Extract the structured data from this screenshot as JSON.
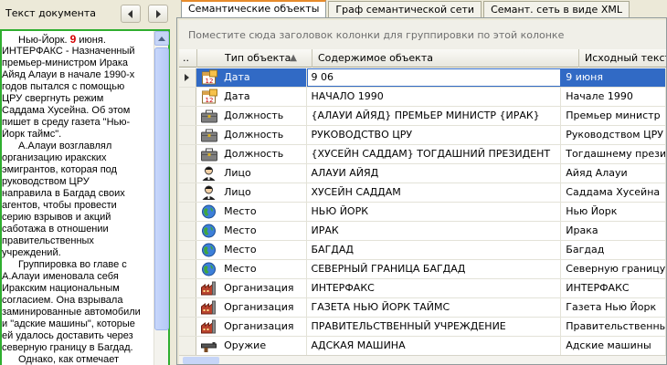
{
  "left_panel": {
    "title": "Текст документа",
    "document_lines": [
      {
        "parts": [
          {
            "t": "Нью-Йорк. "
          },
          {
            "t": "9",
            "hl": true
          },
          {
            "t": " июня."
          }
        ],
        "indent": true
      },
      {
        "parts": [
          {
            "t": "ИНТЕРФАКС - Назначенный"
          }
        ]
      },
      {
        "parts": [
          {
            "t": "премьер-министром Ирака"
          }
        ]
      },
      {
        "parts": [
          {
            "t": "Айяд  Алауи  в начале 1990-х"
          }
        ]
      },
      {
        "parts": [
          {
            "t": "годов пытался  с  помощью"
          }
        ]
      },
      {
        "parts": [
          {
            "t": "ЦРУ свергнуть  режим"
          }
        ]
      },
      {
        "parts": [
          {
            "t": "Саддама Хусейна.  Об этом"
          }
        ]
      },
      {
        "parts": [
          {
            "t": "пишет  в  среду газета \"Нью-"
          }
        ]
      },
      {
        "parts": [
          {
            "t": "Йорк таймс\"."
          }
        ]
      },
      {
        "parts": [
          {
            "t": "А.Алауи возглавлял"
          }
        ],
        "indent": true
      },
      {
        "parts": [
          {
            "t": "организацию иракских"
          }
        ]
      },
      {
        "parts": [
          {
            "t": "эмигрантов, которая под"
          }
        ]
      },
      {
        "parts": [
          {
            "t": "руководством   ЦРУ"
          }
        ]
      },
      {
        "parts": [
          {
            "t": "направила в Багдад своих"
          }
        ]
      },
      {
        "parts": [
          {
            "t": "агентов,  чтобы провести"
          }
        ]
      },
      {
        "parts": [
          {
            "t": "серию  взрывов  и  акций"
          }
        ]
      },
      {
        "parts": [
          {
            "t": "саботажа  в  отношении"
          }
        ]
      },
      {
        "parts": [
          {
            "t": "правительственных"
          }
        ]
      },
      {
        "parts": [
          {
            "t": "учреждений."
          }
        ]
      },
      {
        "parts": [
          {
            "t": "Группировка  во главе с"
          }
        ],
        "indent": true
      },
      {
        "parts": [
          {
            "t": "А.Алауи именовала  себя"
          }
        ]
      },
      {
        "parts": [
          {
            "t": "Иракским национальным"
          }
        ]
      },
      {
        "parts": [
          {
            "t": "согласием.  Она взрывала"
          }
        ]
      },
      {
        "parts": [
          {
            "t": "заминированные  автомобили"
          }
        ]
      },
      {
        "parts": [
          {
            "t": "и \"адские машины\", которые"
          }
        ]
      },
      {
        "parts": [
          {
            "t": "ей удалось доставить  через"
          }
        ]
      },
      {
        "parts": [
          {
            "t": "северную границу в Багдад."
          }
        ]
      },
      {
        "parts": [
          {
            "t": "Однако,  как отмечает"
          }
        ],
        "indent": true
      }
    ]
  },
  "tabs": [
    {
      "label": "Семантические объекты",
      "active": true
    },
    {
      "label": "Граф семантической сети",
      "active": false
    },
    {
      "label": "Семант. сеть в виде XML",
      "active": false
    }
  ],
  "group_panel_text": "Поместите сюда заголовок колонки для группировки по этой колонке",
  "grid": {
    "columns": [
      "..",
      "Тип объекта",
      "Содержимое объекта",
      "Исходный текст"
    ],
    "rows": [
      {
        "type": "Дата",
        "icon": "calendar-icon",
        "content": "9 06",
        "source": "9 июня",
        "selected": true
      },
      {
        "type": "Дата",
        "icon": "calendar-icon",
        "content": "НАЧАЛО 1990",
        "source": "Начале 1990"
      },
      {
        "type": "Должность",
        "icon": "briefcase-icon",
        "content": "{АЛАУИ АЙЯД} ПРЕМЬЕР МИНИСТР {ИРАК}",
        "source": "Премьер министр"
      },
      {
        "type": "Должность",
        "icon": "briefcase-icon",
        "content": "РУКОВОДСТВО ЦРУ",
        "source": "Руководством ЦРУ"
      },
      {
        "type": "Должность",
        "icon": "briefcase-icon",
        "content": "{ХУСЕЙН САДДАМ} ТОГДАШНИЙ ПРЕЗИДЕНТ",
        "source": "Тогдашнему президенту"
      },
      {
        "type": "Лицо",
        "icon": "person-icon",
        "content": "АЛАУИ АЙЯД",
        "source": "Айяд Алауи"
      },
      {
        "type": "Лицо",
        "icon": "person-icon",
        "content": "ХУСЕЙН САДДАМ",
        "source": "Саддама Хусейна"
      },
      {
        "type": "Место",
        "icon": "globe-icon",
        "content": "НЬЮ ЙОРК",
        "source": "Нью Йорк"
      },
      {
        "type": "Место",
        "icon": "globe-icon",
        "content": "ИРАК",
        "source": "Ирака"
      },
      {
        "type": "Место",
        "icon": "globe-icon",
        "content": "БАГДАД",
        "source": "Багдад"
      },
      {
        "type": "Место",
        "icon": "globe-icon",
        "content": "СЕВЕРНЫЙ ГРАНИЦА БАГДАД",
        "source": "Северную границу"
      },
      {
        "type": "Организация",
        "icon": "factory-icon",
        "content": "ИНТЕРФАКС",
        "source": "ИНТЕРФАКС"
      },
      {
        "type": "Организация",
        "icon": "factory-icon",
        "content": "ГАЗЕТА НЬЮ ЙОРК ТАЙМС",
        "source": "Газета Нью Йорк"
      },
      {
        "type": "Организация",
        "icon": "factory-icon",
        "content": "ПРАВИТЕЛЬСТВЕННЫЙ УЧРЕЖДЕНИЕ",
        "source": "Правительственных"
      },
      {
        "type": "Оружие",
        "icon": "weapon-icon",
        "content": "АДСКАЯ МАШИНА",
        "source": "Адские машины"
      }
    ]
  },
  "colors": {
    "selection": "#316ac5",
    "doc_border": "#2fae2f",
    "tab_accent": "#e68b2c"
  }
}
